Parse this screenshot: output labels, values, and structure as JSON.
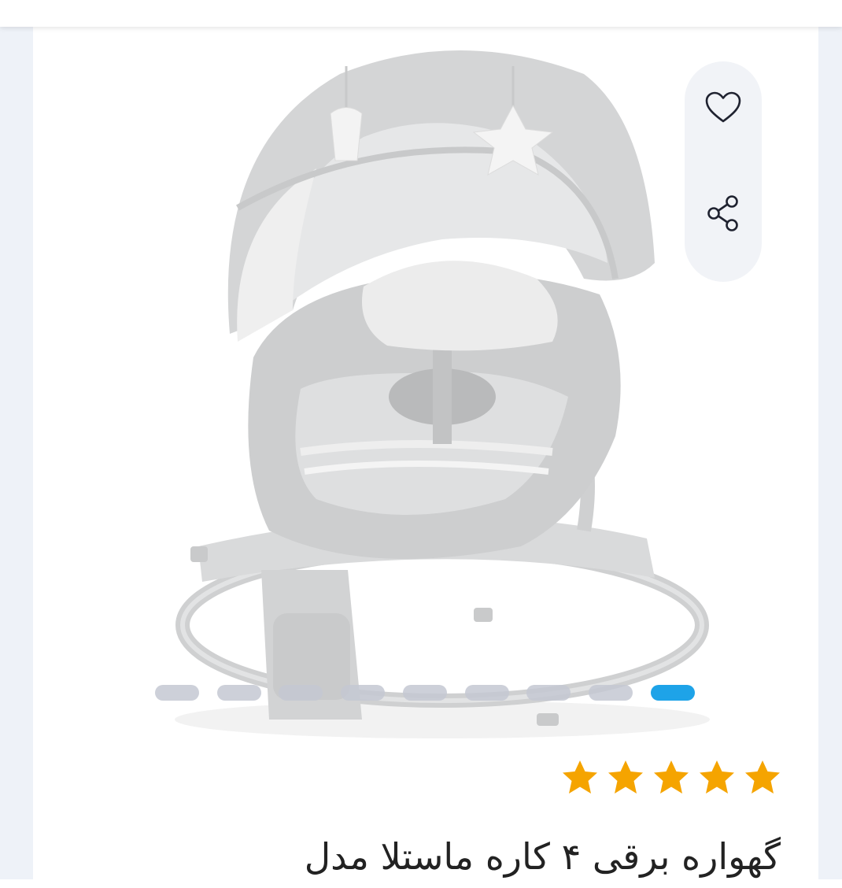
{
  "product": {
    "title": "گهواره برقی ۴ کاره ماستلا مدل",
    "image_alt": "baby swing product photo"
  },
  "actions": {
    "favorite_icon": "heart-outline-icon",
    "share_icon": "share-icon"
  },
  "gallery": {
    "total_slides": 9,
    "active_slide": 9,
    "active_color": "#1ea3e8",
    "inactive_color": "#c4c8d2"
  },
  "rating": {
    "stars": 5,
    "max": 5,
    "star_color": "#f5a400"
  }
}
